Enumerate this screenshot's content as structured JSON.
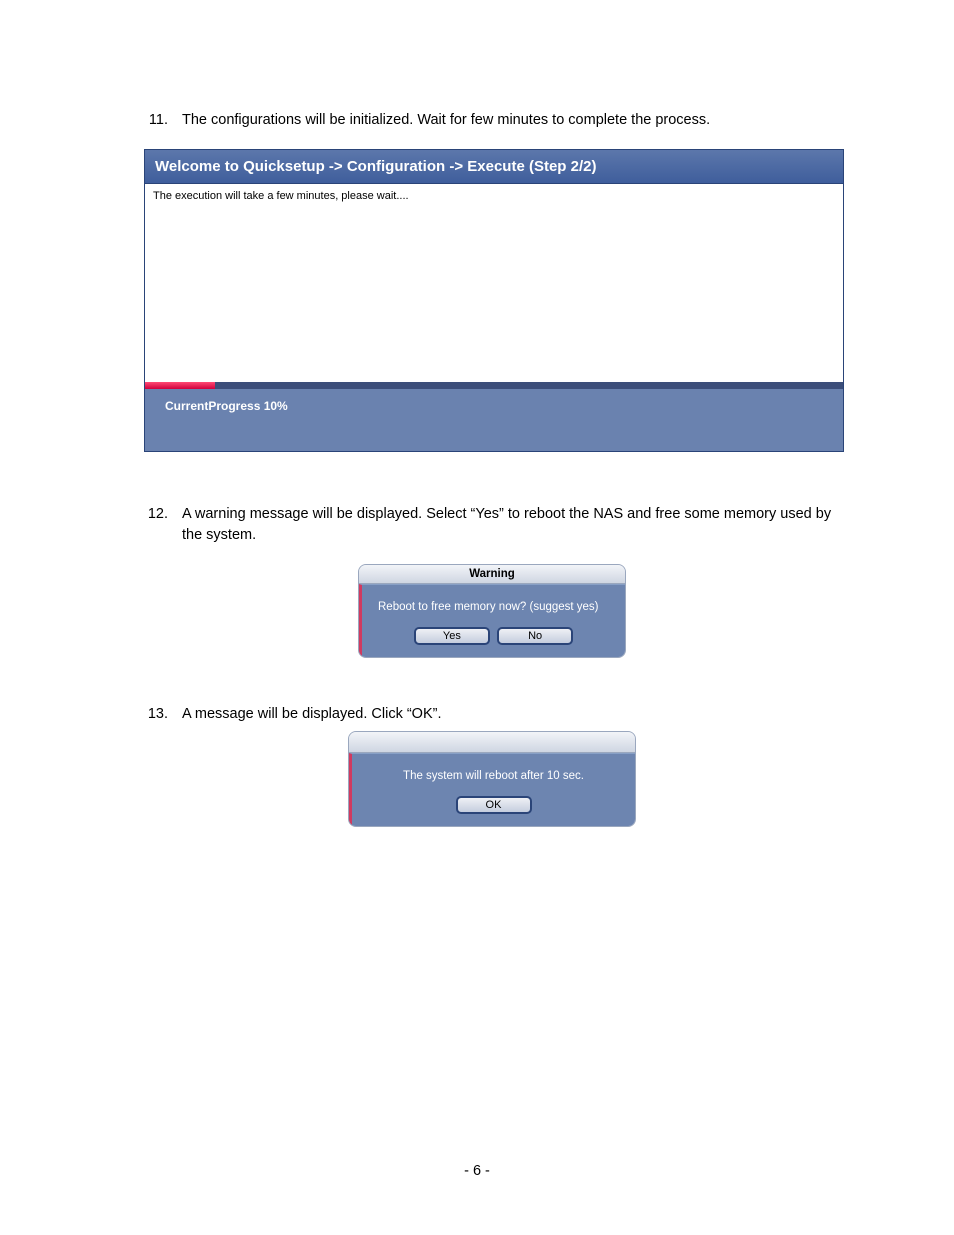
{
  "steps": {
    "s11": {
      "num": "11.",
      "text": "The configurations will be initialized. Wait for few minutes to complete the process."
    },
    "s12": {
      "num": "12.",
      "text": "A warning message will be displayed. Select “Yes” to reboot the NAS and free some memory used by the system."
    },
    "s13": {
      "num": "13.",
      "text": "A message will be displayed. Click “OK”."
    }
  },
  "quicksetup": {
    "title": "Welcome to Quicksetup -> Configuration -> Execute (Step 2/2)",
    "body_text": "The execution will take a few minutes, please wait....",
    "progress_label": "CurrentProgress 10%",
    "progress_pct": "10%"
  },
  "warning_dialog": {
    "title": "Warning",
    "message": "Reboot to free memory now? (suggest yes)",
    "yes_label": "Yes",
    "no_label": "No"
  },
  "reboot_dialog": {
    "message": "The system will reboot after 10 sec.",
    "ok_label": "OK"
  },
  "page_number": "- 6 -"
}
